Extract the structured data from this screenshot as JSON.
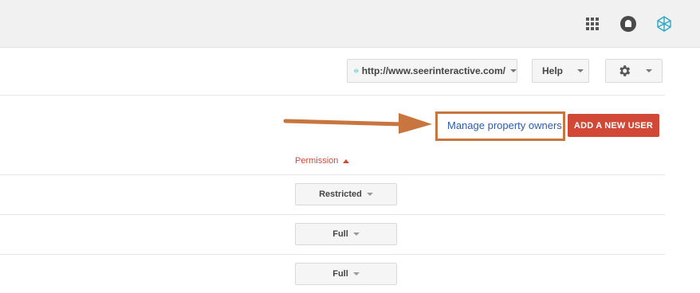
{
  "topbar": {
    "apps_icon": "apps-grid-icon",
    "notifications_icon": "bell-icon",
    "avatar_icon": "avatar-icon"
  },
  "toolbar": {
    "property_url": "http://www.seerinteractive.com/",
    "help_label": "Help",
    "settings_icon": "gear-icon"
  },
  "actions": {
    "manage_owners_label": "Manage property owners",
    "add_user_label": "ADD A NEW USER",
    "highlight_color": "#c8753f",
    "add_user_color": "#d14836"
  },
  "table": {
    "permission_header": "Permission",
    "rows": [
      {
        "permission": "Restricted"
      },
      {
        "permission": "Full"
      },
      {
        "permission": "Full"
      }
    ]
  }
}
